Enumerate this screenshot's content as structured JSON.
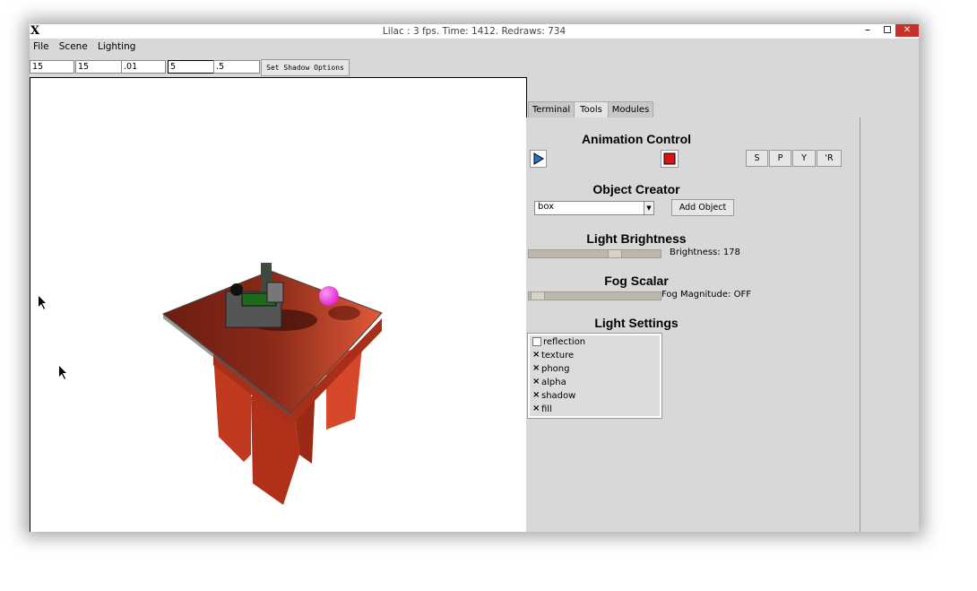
{
  "window": {
    "title": "Lilac : 3 fps. Time: 1412. Redraws: 734",
    "app_icon": "X"
  },
  "menu": [
    "File",
    "Scene",
    "Lighting"
  ],
  "shadow_fields": [
    "15",
    "15",
    ".01",
    "5",
    ".5"
  ],
  "shadow_button": "Set Shadow Options",
  "tabs": [
    "Terminal",
    "Tools",
    "Modules"
  ],
  "active_tab": "Tools",
  "animation": {
    "title": "Animation Control",
    "buttons": [
      "S",
      "P",
      "Y",
      "'R"
    ]
  },
  "object_creator": {
    "title": "Object Creator",
    "selected": "box",
    "add_label": "Add Object"
  },
  "brightness": {
    "title": "Light Brightness",
    "label": "Brightness: 178",
    "value": 178
  },
  "fog": {
    "title": "Fog Scalar",
    "label": "Fog Magnitude: OFF"
  },
  "light_settings": {
    "title": "Light Settings",
    "options": [
      {
        "label": "reflection",
        "checked": false
      },
      {
        "label": "texture",
        "checked": true
      },
      {
        "label": "phong",
        "checked": true
      },
      {
        "label": "alpha",
        "checked": true
      },
      {
        "label": "shadow",
        "checked": true
      },
      {
        "label": "fill",
        "checked": true
      }
    ]
  },
  "colors": {
    "table_red": "#c0391f",
    "sphere_pink": "#ee33dd",
    "stop_red": "#dd1111",
    "play_blue": "#2277cc"
  }
}
